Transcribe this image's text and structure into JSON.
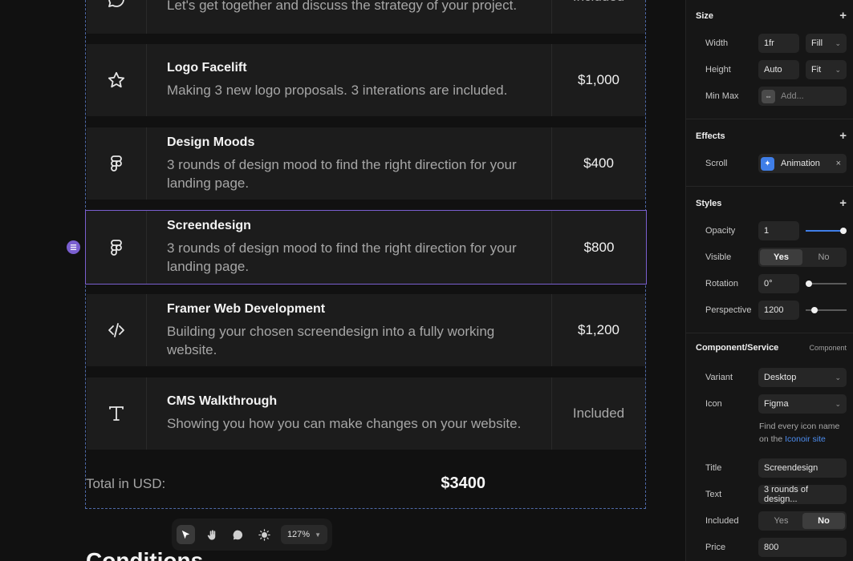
{
  "rows": [
    {
      "title": "",
      "desc": "Let's get together and discuss the strategy of your project.",
      "price": "Included",
      "icon": "chat-bubble-icon"
    },
    {
      "title": "Logo Facelift",
      "desc": "Making 3 new logo proposals. 3 interations are included.",
      "price": "$1,000",
      "icon": "star-icon"
    },
    {
      "title": "Design Moods",
      "desc": "3 rounds of design mood to find the right direction for your landing page.",
      "price": "$400",
      "icon": "figma-icon"
    },
    {
      "title": "Screendesign",
      "desc": "3 rounds of design mood to find the right direction for your landing page.",
      "price": "$800",
      "icon": "figma-icon"
    },
    {
      "title": "Framer Web Development",
      "desc": "Building your chosen screendesign into a fully working website.",
      "price": "$1,200",
      "icon": "code-icon"
    },
    {
      "title": "CMS Walkthrough",
      "desc": "Showing you how you can make changes on your website.",
      "price": "Included",
      "icon": "text-icon"
    }
  ],
  "total": {
    "label": "Total in USD:",
    "value": "$3400"
  },
  "next_heading": "Conditions",
  "toolbar": {
    "zoom": "127%"
  },
  "panel": {
    "size": {
      "heading": "Size",
      "width_label": "Width",
      "width_value": "1fr",
      "width_mode": "Fill",
      "height_label": "Height",
      "height_value": "Auto",
      "height_mode": "Fit",
      "minmax_label": "Min Max",
      "minmax_placeholder": "Add..."
    },
    "effects": {
      "heading": "Effects",
      "scroll_label": "Scroll",
      "scroll_value": "Animation"
    },
    "styles": {
      "heading": "Styles",
      "opacity_label": "Opacity",
      "opacity_value": "1",
      "visible_label": "Visible",
      "visible_yes": "Yes",
      "visible_no": "No",
      "rotation_label": "Rotation",
      "rotation_value": "0°",
      "perspective_label": "Perspective",
      "perspective_value": "1200"
    },
    "component": {
      "heading": "Component/Service",
      "sub": "Component",
      "variant_label": "Variant",
      "variant_value": "Desktop",
      "icon_label": "Icon",
      "icon_value": "Figma",
      "note_text": "Find every icon name on the",
      "note_link": "Iconoir site",
      "title_label": "Title",
      "title_value": "Screendesign",
      "text_label": "Text",
      "text_value": "3 rounds of design...",
      "included_label": "Included",
      "included_yes": "Yes",
      "included_no": "No",
      "price_label": "Price",
      "price_value": "800"
    }
  },
  "colors": {
    "accent": "#3f7ee8",
    "selection": "#7a5fd0"
  }
}
